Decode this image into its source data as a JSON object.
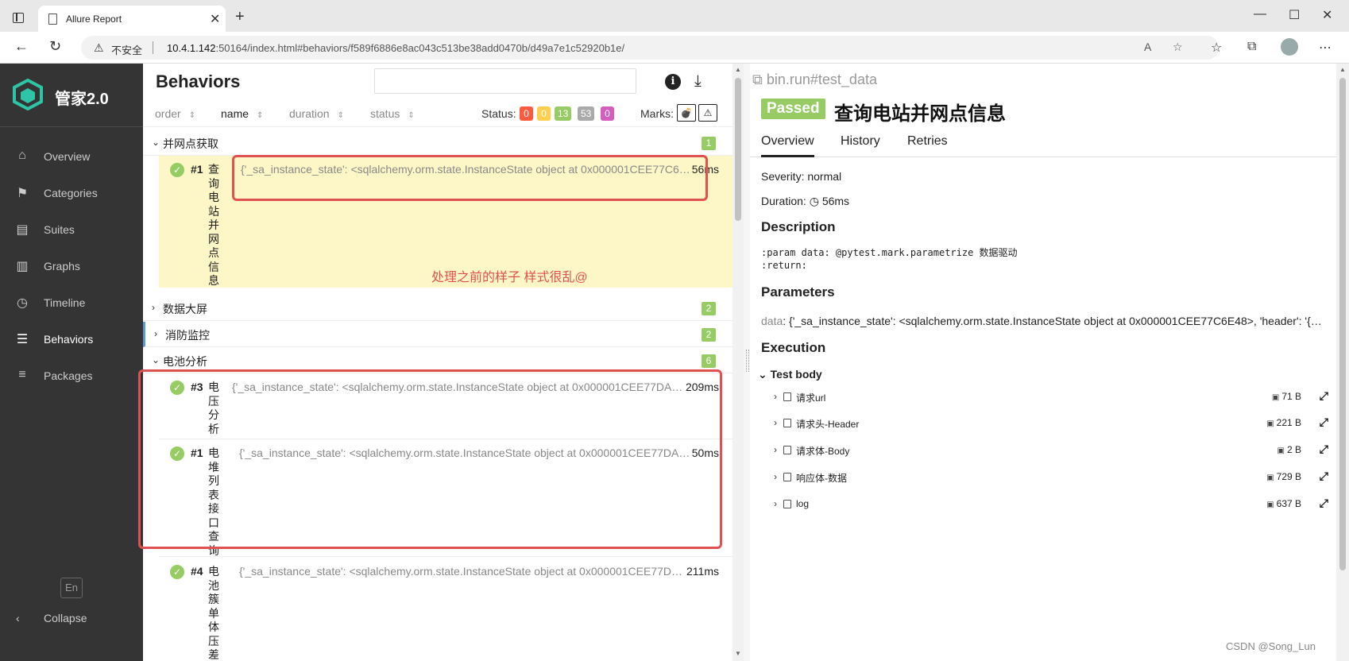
{
  "browser": {
    "tab_title": "Allure Report",
    "insecure_label": "不安全",
    "url_host": "10.4.1.142",
    "url_rest": ":50164/index.html#behaviors/f589f6886e8ac043c513be38add0470b/d49a7e1c52920b1e/"
  },
  "sidebar": {
    "app_title": "管家2.0",
    "items": [
      {
        "label": "Overview",
        "icon": "home-icon"
      },
      {
        "label": "Categories",
        "icon": "flag-icon"
      },
      {
        "label": "Suites",
        "icon": "briefcase-icon"
      },
      {
        "label": "Graphs",
        "icon": "bar-chart-icon"
      },
      {
        "label": "Timeline",
        "icon": "clock-icon"
      },
      {
        "label": "Behaviors",
        "icon": "list-icon"
      },
      {
        "label": "Packages",
        "icon": "align-left-icon"
      }
    ],
    "active": "Behaviors",
    "lang": "En",
    "collapse": "Collapse"
  },
  "behaviors": {
    "title": "Behaviors",
    "sort": {
      "order": "order",
      "name": "name",
      "duration": "duration",
      "status": "status"
    },
    "status_label": "Status:",
    "status_counts": [
      {
        "value": "0",
        "color": "#fd5a3e"
      },
      {
        "value": "0",
        "color": "#ffd050"
      },
      {
        "value": "13",
        "color": "#97cc64"
      },
      {
        "value": "53",
        "color": "#aaaaaa"
      },
      {
        "value": "0",
        "color": "#d35ebe"
      }
    ],
    "marks_label": "Marks:",
    "groups": [
      {
        "name": "并网点获取",
        "count": "1",
        "expanded": true
      },
      {
        "name": "数据大屏",
        "count": "2",
        "expanded": false
      },
      {
        "name": "消防监控",
        "count": "2",
        "expanded": false
      },
      {
        "name": "电池分析",
        "count": "6",
        "expanded": true
      }
    ],
    "cases": [
      {
        "num": "#1",
        "name": "查询电站并网点信息",
        "params": "{'_sa_instance_state': <sqlalchemy.orm.state.InstanceState object at 0x000001CEE77C6…",
        "duration": "56ms"
      },
      {
        "num": "#3",
        "name": "电压分析",
        "params": "{'_sa_instance_state': <sqlalchemy.orm.state.InstanceState object at 0x000001CEE77DA…",
        "duration": "209ms"
      },
      {
        "num": "#1",
        "name": "电堆列表接口查询",
        "params": "{'_sa_instance_state': <sqlalchemy.orm.state.InstanceState object at 0x000001CEE77DA…",
        "duration": "50ms"
      },
      {
        "num": "#4",
        "name": "电池簇单体压差分",
        "params": "{'_sa_instance_state': <sqlalchemy.orm.state.InstanceState object at 0x000001CEE77D…",
        "duration": "211ms"
      }
    ],
    "annotation": "处理之前的样子 样式很乱@"
  },
  "detail": {
    "crumb": "bin.run#test_data",
    "status": "Passed",
    "title": "查询电站并网点信息",
    "tabs": [
      "Overview",
      "History",
      "Retries"
    ],
    "severity_label": "Severity:",
    "severity": "normal",
    "duration_label": "Duration:",
    "duration": "56ms",
    "description_h": "Description",
    "description": ":param data: @pytest.mark.parametrize 数据驱动\n:return:",
    "parameters_h": "Parameters",
    "param_key": "data",
    "param_value": ": {'_sa_instance_state': <sqlalchemy.orm.state.InstanceState object at 0x000001CEE77C6E48>, 'header': '{…",
    "execution_h": "Execution",
    "test_body": "Test body",
    "attachments": [
      {
        "name": "请求url",
        "size": "71 B"
      },
      {
        "name": "请求头-Header",
        "size": "221 B"
      },
      {
        "name": "请求体-Body",
        "size": "2 B"
      },
      {
        "name": "响应体-数据",
        "size": "729 B"
      },
      {
        "name": "log",
        "size": "637 B"
      }
    ]
  },
  "watermark": "CSDN @Song_Lun"
}
